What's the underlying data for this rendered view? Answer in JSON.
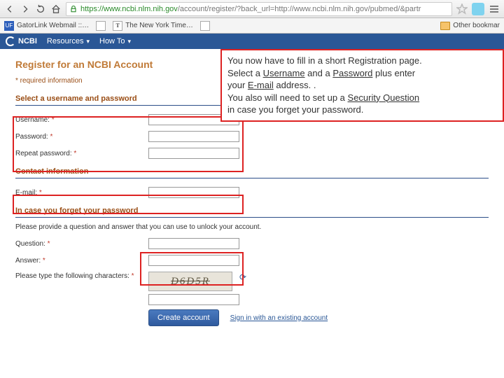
{
  "browser": {
    "url_https": "https://",
    "url_host": "www.ncbi.nlm.nih.gov",
    "url_path": "/account/register/?back_url=http://www.ncbi.nlm.nih.gov/pubmed/&partr"
  },
  "bookmarks": {
    "b0": "GatorLink Webmail ::…",
    "b1": "The New York Time…",
    "other": "Other bookmar"
  },
  "ncbi": {
    "logo": "NCBI",
    "resources": "Resources",
    "howto": "How To"
  },
  "page": {
    "title": "Register for an NCBI Account",
    "required_note": "* required information",
    "sec1": "Select a username and password",
    "username_label": "Username: ",
    "password_label": "Password: ",
    "repeat_label": "Repeat password: ",
    "sec2": "Contact information",
    "email_label": "E-mail: ",
    "sec3": "In case you forget your password",
    "hint": "Please provide a question and answer that you can use to unlock your account.",
    "question_label": "Question: ",
    "answer_label": "Answer: ",
    "captcha_label": "Please type the following characters: ",
    "captcha_text": "D6D5R",
    "asterisk": "*",
    "submit": "Create account",
    "signin": "Sign in with an existing account"
  },
  "callout": {
    "l1a": "You now have to fill in a short Registration page.",
    "l2a": "Select a ",
    "l2u1": "Username",
    "l2b": " and a ",
    "l2u2": "Password",
    "l2c": " plus enter",
    "l3a": "your ",
    "l3u1": "E-mail",
    "l3b": " address. .",
    "l4a": "You also will need to set up a ",
    "l4u1": "Security Question",
    "l5a": "in case you forget your password."
  }
}
